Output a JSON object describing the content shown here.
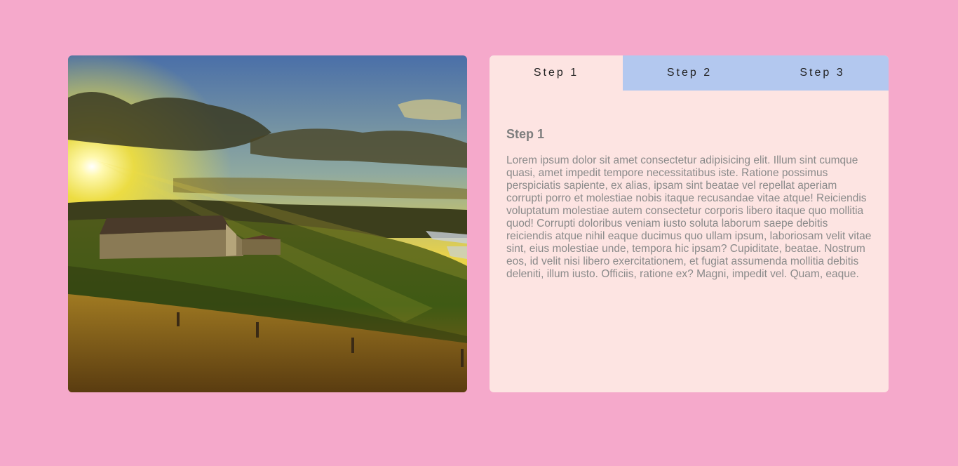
{
  "photo": {
    "description_icon": "landscape-image"
  },
  "tabs": [
    {
      "label": "Step 1",
      "active": true
    },
    {
      "label": "Step 2",
      "active": false
    },
    {
      "label": "Step 3",
      "active": false
    }
  ],
  "panel": {
    "title": "Step 1",
    "body": "Lorem ipsum dolor sit amet consectetur adipisicing elit. Illum sint cumque quasi, amet impedit tempore necessitatibus iste. Ratione possimus perspiciatis sapiente, ex alias, ipsam sint beatae vel repellat aperiam corrupti porro et molestiae nobis itaque recusandae vitae atque! Reiciendis voluptatum molestiae autem consectetur corporis libero itaque quo mollitia quod! Corrupti doloribus veniam iusto soluta laborum saepe debitis reiciendis atque nihil eaque ducimus quo ullam ipsum, laboriosam velit vitae sint, eius molestiae unde, tempora hic ipsam? Cupiditate, beatae. Nostrum eos, id velit nisi libero exercitationem, et fugiat assumenda mollitia debitis deleniti, illum iusto. Officiis, ratione ex? Magni, impedit vel. Quam, eaque."
  },
  "colors": {
    "page_background": "#f5a9cb",
    "panel_background": "#fde4e2",
    "tab_inactive": "#b3c8ef"
  }
}
